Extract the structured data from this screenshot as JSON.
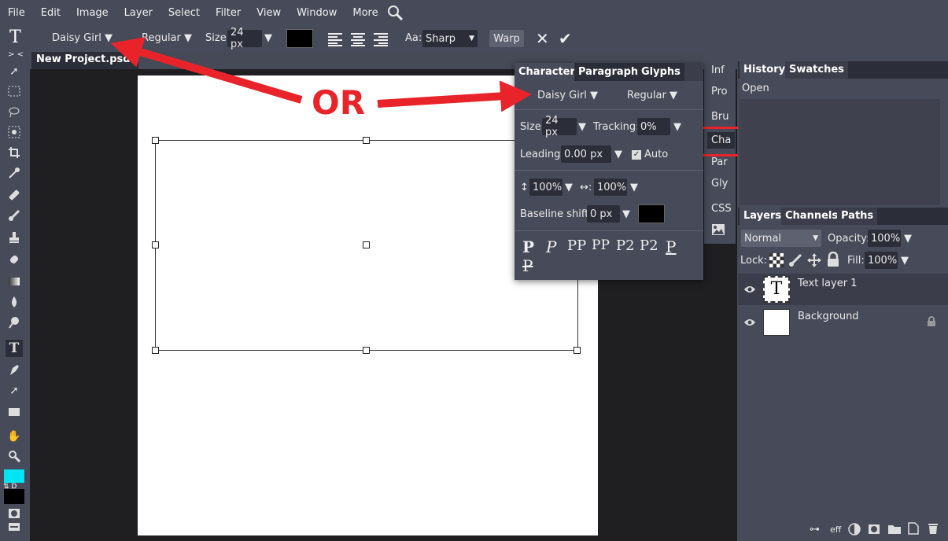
{
  "menubar": {
    "items": [
      "File",
      "Edit",
      "Image",
      "Layer",
      "Select",
      "Filter",
      "View",
      "Window",
      "More"
    ]
  },
  "options": {
    "tool_glyph": "T",
    "font": "Daisy Girl ▼",
    "style": "Regular ▼",
    "size_label": "Size:",
    "size_value": "24 px",
    "dd_arrow": "▼",
    "aa_label": "Aa:",
    "aa_value": "Sharp",
    "warp_label": "Warp",
    "cancel": "✕",
    "confirm": "✔"
  },
  "collapse_left": "> <",
  "collapse_mid": "< >",
  "collapse_right": "> <",
  "doc_tab": {
    "title": "New Project.psd",
    "close": "✕"
  },
  "annotation": {
    "text": "OR",
    "color": "#e8242a"
  },
  "character_panel": {
    "tabs": [
      "Character",
      "Paragraph",
      "Glyphs"
    ],
    "font": "Daisy Girl ▼",
    "style": "Regular ▼",
    "size_label": "Size:",
    "size_value": "24 px",
    "tracking_label": "Tracking:",
    "tracking_value": "0%",
    "leading_label": "Leading:",
    "leading_value": "0.00 px",
    "auto_label": "Auto",
    "vscale_label": "↕:",
    "vscale_value": "100%",
    "hscale_label": "↔:",
    "hscale_value": "100%",
    "baseline_label": "Baseline shift:",
    "baseline_value": "0 px",
    "glyph_buttons": [
      "P",
      "P",
      "PP",
      "PP",
      "P2",
      "P2",
      "P",
      "P"
    ]
  },
  "right_strip": {
    "items": [
      "Inf",
      "Pro",
      "Bru",
      "Cha",
      "Par",
      "Gly",
      "CSS"
    ],
    "highlight_color": "#e8242a"
  },
  "history_panel": {
    "tabs": [
      "History",
      "Swatches"
    ],
    "entries": [
      "Open"
    ]
  },
  "layers_panel": {
    "tabs": [
      "Layers",
      "Channels",
      "Paths"
    ],
    "blend_mode": "Normal",
    "opacity_label": "Opacity:",
    "opacity_value": "100%",
    "lock_label": "Lock:",
    "fill_label": "Fill:",
    "fill_value": "100%",
    "layers": [
      {
        "name": "Text layer 1",
        "thumb": "T"
      },
      {
        "name": "Background",
        "thumb": ""
      }
    ],
    "footer_eff": "eff"
  },
  "colors": {
    "foreground": "#00e5f2",
    "background": "#000000",
    "accent": "#e8242a"
  }
}
